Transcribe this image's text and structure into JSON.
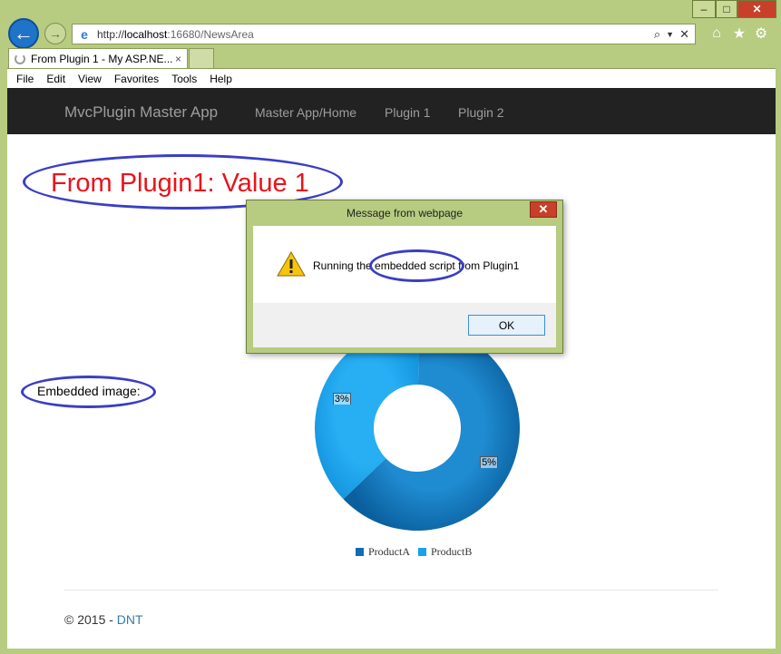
{
  "browser": {
    "address": {
      "scheme": "http://",
      "host": "localhost",
      "port_path": ":16680/NewsArea"
    },
    "tab_title": "From Plugin 1 - My ASP.NE...",
    "tab_close": "×",
    "menu": [
      "File",
      "Edit",
      "View",
      "Favorites",
      "Tools",
      "Help"
    ],
    "window_buttons": {
      "minimize": "–",
      "maximize": "□",
      "close": "✕"
    }
  },
  "site": {
    "brand": "MvcPlugin Master App",
    "nav": [
      "Master App/Home",
      "Plugin 1",
      "Plugin 2"
    ]
  },
  "page": {
    "heading": "From Plugin1: Value 1",
    "embedded_label": "Embedded image:",
    "footer_prefix": "© 2015 - ",
    "footer_link": "DNT"
  },
  "dialog": {
    "title": "Message from webpage",
    "message": "Running the embedded script from Plugin1",
    "ok_label": "OK",
    "close_label": "✕"
  },
  "chart_data": {
    "type": "pie",
    "donut": true,
    "categories": [
      "ProductA",
      "ProductB"
    ],
    "values": [
      5,
      3
    ],
    "data_labels": [
      "5%",
      "3%"
    ],
    "legend_position": "bottom",
    "colors": {
      "ProductA": "#0e6db3",
      "ProductB": "#1aa1ec"
    }
  },
  "colors": {
    "frame": "#b7cb81",
    "navbar": "#222222",
    "heading": "#e8141b",
    "annotation": "#3a3ec4",
    "link": "#337ab7"
  }
}
